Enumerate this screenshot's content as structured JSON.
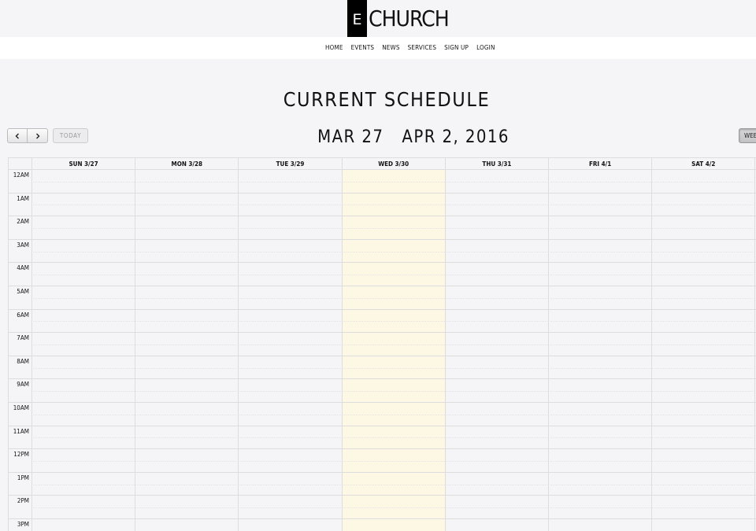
{
  "logo": {
    "letter": "E",
    "text": "CHURCH"
  },
  "nav": {
    "items": [
      "HOME",
      "EVENTS",
      "NEWS",
      "SERVICES",
      "SIGN UP",
      "LOGIN"
    ]
  },
  "page_title": "CURRENT SCHEDULE",
  "toolbar": {
    "prev_icon": "chevron-left-icon",
    "next_icon": "chevron-right-icon",
    "today_label": "TODAY",
    "week_label": "WEEK"
  },
  "range_title": "MAR 27   APR 2, 2016",
  "calendar": {
    "days": [
      "SUN 3/27",
      "MON 3/28",
      "TUE 3/29",
      "WED 3/30",
      "THU 3/31",
      "FRI 4/1",
      "SAT 4/2"
    ],
    "highlighted_day": "WED 3/30",
    "hours": [
      "12AM",
      "1AM",
      "2AM",
      "3AM",
      "4AM",
      "5AM",
      "6AM",
      "7AM",
      "8AM",
      "9AM",
      "10AM",
      "11AM",
      "12PM",
      "1PM",
      "2PM",
      "3PM"
    ]
  },
  "colors": {
    "background": "#f5f5f7",
    "today_highlight": "#fcf8e3",
    "logo_box": "#000000",
    "grid_line": "#dddddd"
  }
}
